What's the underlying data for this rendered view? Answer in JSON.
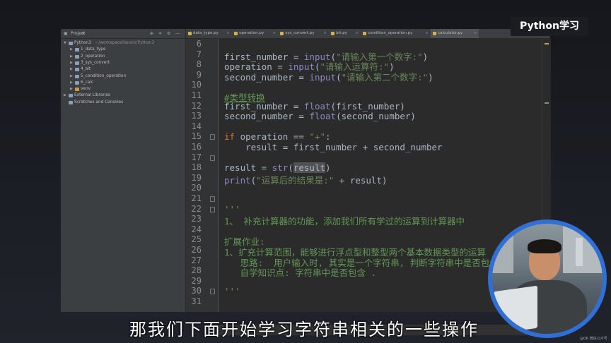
{
  "badge": "Python学习",
  "subtitle": "那我们下面开始学习字符串相关的一些操作",
  "watermark": "@OK 微信公众号",
  "project_panel": {
    "title": "Project",
    "tree": [
      {
        "label": "Python3",
        "path": " ~/workspace/tanxin/Python3",
        "indent": 0,
        "arrow": "▼",
        "folder_color": "#8da0b4"
      },
      {
        "label": "1_data_type",
        "indent": 1,
        "arrow": "▶",
        "folder_color": "#8da0b4"
      },
      {
        "label": "2_operation",
        "indent": 1,
        "arrow": "▶",
        "folder_color": "#8da0b4"
      },
      {
        "label": "3_sys_convert",
        "indent": 1,
        "arrow": "▶",
        "folder_color": "#8da0b4"
      },
      {
        "label": "4_bit",
        "indent": 1,
        "arrow": "▶",
        "folder_color": "#8da0b4"
      },
      {
        "label": "5_condition_operation",
        "indent": 1,
        "arrow": "▶",
        "folder_color": "#8da0b4"
      },
      {
        "label": "6_calc",
        "indent": 1,
        "arrow": "▶",
        "folder_color": "#8da0b4"
      },
      {
        "label": "venv",
        "indent": 1,
        "arrow": "▶",
        "folder_color": "#c79b4a"
      },
      {
        "label": "External Libraries",
        "indent": 0,
        "arrow": "▶",
        "folder_color": "#8da0b4"
      },
      {
        "label": "Scratches and Consoles",
        "indent": 0,
        "arrow": "",
        "folder_color": "#8da0b4"
      }
    ]
  },
  "tabs": [
    {
      "label": "data_type.py",
      "active": false
    },
    {
      "label": "operation.py",
      "active": false
    },
    {
      "label": "sys_convert.py",
      "active": false
    },
    {
      "label": "bit.py",
      "active": false
    },
    {
      "label": "condition_operation.py",
      "active": false
    },
    {
      "label": "calculator.py",
      "active": true
    }
  ],
  "editor": {
    "line_numbers": [
      "6",
      "7",
      "8",
      "9",
      "10",
      "11",
      "12",
      "13",
      "14",
      "15",
      "16",
      "17",
      "18",
      "19",
      "20",
      "21",
      "22",
      "23",
      "24",
      "25",
      "26",
      "27",
      "28",
      "29",
      "30",
      "31"
    ],
    "lines": [
      [],
      [
        {
          "t": "first_number = "
        },
        {
          "t": "input",
          "c": "f"
        },
        {
          "t": "("
        },
        {
          "t": "\"请输入第一个数字:\"",
          "c": "s"
        },
        {
          "t": ")"
        }
      ],
      [
        {
          "t": "operation = "
        },
        {
          "t": "input",
          "c": "f"
        },
        {
          "t": "("
        },
        {
          "t": "\"请输入运算符:\"",
          "c": "s"
        },
        {
          "t": ")"
        }
      ],
      [
        {
          "t": "second_number = "
        },
        {
          "t": "input",
          "c": "f"
        },
        {
          "t": "("
        },
        {
          "t": "\"请输入第二个数字:\"",
          "c": "s"
        },
        {
          "t": ")"
        }
      ],
      [],
      [
        {
          "t": "#类型转换",
          "c": "cm"
        }
      ],
      [
        {
          "t": "first_number = "
        },
        {
          "t": "float",
          "c": "f"
        },
        {
          "t": "(first_number)"
        }
      ],
      [
        {
          "t": "second_number = "
        },
        {
          "t": "float",
          "c": "f"
        },
        {
          "t": "(second_number)"
        }
      ],
      [],
      [
        {
          "t": "if",
          "c": "k"
        },
        {
          "t": " operation == "
        },
        {
          "t": "\"+\"",
          "c": "s"
        },
        {
          "t": ":"
        }
      ],
      [
        {
          "t": "    result = first_number + second_number"
        }
      ],
      [],
      [
        {
          "t": "result = "
        },
        {
          "t": "str",
          "c": "f"
        },
        {
          "t": "("
        },
        {
          "t": "result",
          "c": "hl"
        },
        {
          "t": ")"
        }
      ],
      [
        {
          "t": "print",
          "c": "f"
        },
        {
          "t": "("
        },
        {
          "t": "\"运算后的结果是:\"",
          "c": "s"
        },
        {
          "t": " + result)"
        }
      ],
      [],
      [],
      [
        {
          "t": "'''",
          "c": "c"
        }
      ],
      [
        {
          "t": "1、 补充计算器的功能，添加我们所有学过的运算到计算器中",
          "c": "c"
        }
      ],
      [],
      [
        {
          "t": "扩展作业:",
          "c": "c"
        }
      ],
      [
        {
          "t": "1、扩充计算范围，能够进行浮点型和整型两个基本数据类型的运算",
          "c": "c"
        }
      ],
      [
        {
          "t": "   思路:  用户输入时, 其实是一个字符串, 判断字符串中是否包含",
          "c": "c"
        }
      ],
      [
        {
          "t": "   自学知识点: 字符串中是否包含 .",
          "c": "c"
        }
      ],
      [],
      [
        {
          "t": "'''",
          "c": "c"
        }
      ],
      []
    ]
  },
  "colors": {
    "editor_bg": "#2b2b2b",
    "sidebar_bg": "#3c3f41",
    "string": "#6a8759",
    "builtin": "#8888c6",
    "keyword": "#cc7832",
    "comment": "#629755",
    "webcam_ring": "#2f6fd6"
  }
}
